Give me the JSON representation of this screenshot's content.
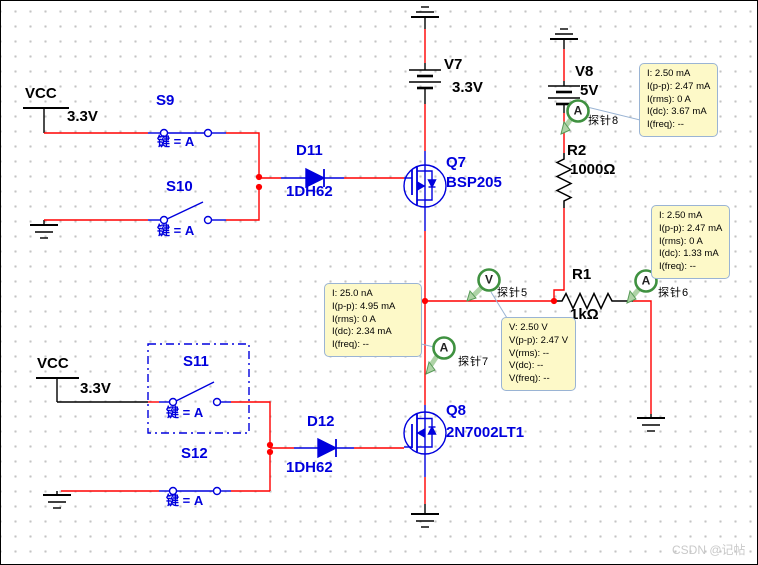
{
  "app": {
    "watermark": "CSDN @记帖"
  },
  "colors": {
    "wire_red": "#ff0000",
    "component_blue": "#0000dd",
    "probe_green": "#3f9140",
    "tooltip_bg": "#fdf9c8",
    "tooltip_border": "#9ab4d4"
  },
  "power": {
    "vcc_top": {
      "label": "VCC",
      "voltage": "3.3V"
    },
    "vcc_bottom": {
      "label": "VCC",
      "voltage": "3.3V"
    },
    "v7": {
      "ref": "V7",
      "value": "3.3V"
    },
    "v8": {
      "ref": "V8",
      "value": "5V"
    }
  },
  "switches": {
    "s9": {
      "ref": "S9",
      "key": "键 = A",
      "state": "closed"
    },
    "s10": {
      "ref": "S10",
      "key": "键 = A",
      "state": "open"
    },
    "s11": {
      "ref": "S11",
      "key": "键 = A",
      "state": "open",
      "selected": true
    },
    "s12": {
      "ref": "S12",
      "key": "键 = A",
      "state": "closed"
    }
  },
  "diodes": {
    "d11": {
      "ref": "D11",
      "part": "1DH62"
    },
    "d12": {
      "ref": "D12",
      "part": "1DH62"
    }
  },
  "transistors": {
    "q7": {
      "ref": "Q7",
      "part": "BSP205"
    },
    "q8": {
      "ref": "Q8",
      "part": "2N7002LT1"
    }
  },
  "resistors": {
    "r2": {
      "ref": "R2",
      "value": "1000Ω"
    },
    "r1": {
      "ref": "R1",
      "value": "1kΩ"
    }
  },
  "probes": [
    {
      "id": "5",
      "type": "V",
      "label": "探针5",
      "readings": [
        "V: 2.50 V",
        "V(p-p): 2.47 V",
        "V(rms): --",
        "V(dc): --",
        "V(freq): --"
      ]
    },
    {
      "id": "6",
      "type": "A",
      "label": "探针6",
      "readings": [
        "I: 2.50 mA",
        "I(p-p): 2.47 mA",
        "I(rms): 0 A",
        "I(dc): 1.33 mA",
        "I(freq): --"
      ]
    },
    {
      "id": "7",
      "type": "A",
      "label": "探针7",
      "readings": [
        "I: 25.0 nA",
        "I(p-p): 4.95 mA",
        "I(rms): 0 A",
        "I(dc): 2.34 mA",
        "I(freq): --"
      ]
    },
    {
      "id": "8",
      "type": "A",
      "label": "探针8",
      "readings": [
        "I: 2.50 mA",
        "I(p-p): 2.47 mA",
        "I(rms): 0 A",
        "I(dc): 3.67 mA",
        "I(freq): --"
      ]
    }
  ]
}
